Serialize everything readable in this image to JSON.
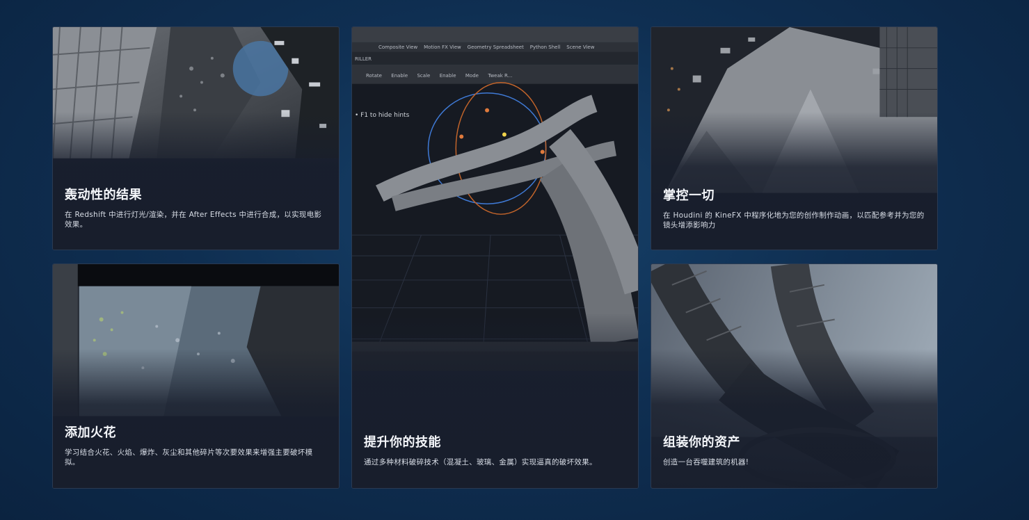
{
  "cards": [
    {
      "title": "轰动性的结果",
      "description": "在 Redshift 中进行灯光/渲染，并在 After Effects 中进行合成，以实现电影效果。"
    },
    {
      "title": "添加火花",
      "description": "学习结合火花、火焰、爆炸、灰尘和其他碎片等次要效果来增强主要破坏模拟。"
    },
    {
      "title": "提升你的技能",
      "description": "通过多种材料破碎技术（混凝土、玻璃、金属）实现逼真的破坏效果。"
    },
    {
      "title": "掌控一切",
      "description": "在 Houdini 的 KineFX 中程序化地为您的创作制作动画，以匹配参考并为您的镜头增添影响力"
    },
    {
      "title": "组装你的资产",
      "description": "创造一台吞噬建筑的机器!"
    }
  ],
  "software_ui": {
    "tabs": [
      "Composite View",
      "Motion FX View",
      "Geometry Spreadsheet",
      "Python Shell",
      "Scene View"
    ],
    "toolbar": [
      "Rotate",
      "Enable",
      "Scale",
      "Enable",
      "Mode",
      "Tweak R..."
    ],
    "panel_title": "RILLER",
    "hint": "F1 to hide hints"
  },
  "colors": {
    "background": "#0f2f52",
    "card": "#1b2232",
    "title": "#f4f6fa"
  }
}
